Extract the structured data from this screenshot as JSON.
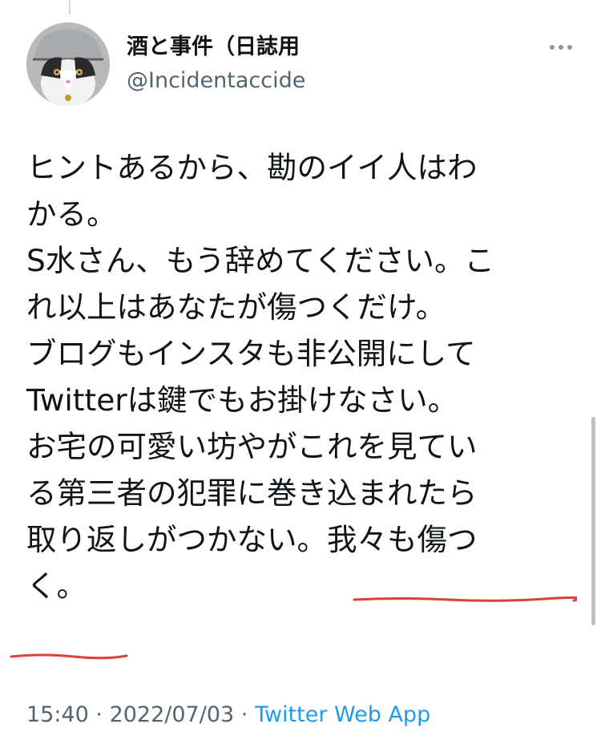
{
  "tweet": {
    "author": {
      "display_name": "酒と事件（日誌用",
      "handle": "@Incidentaccide",
      "avatar_icon": "cat-avatar-icon"
    },
    "more_icon": "more-options-icon",
    "text_lines": [
      "ヒントあるから、勘のイイ人はわ",
      "かる。",
      "S水さん、もう辞めてください。こ",
      "れ以上はあなたが傷つくだけ。",
      "ブログもインスタも非公開にして",
      "Twitterは鍵でもお掛けなさい。",
      "お宅の可愛い坊やがこれを見てい",
      "る第三者の犯罪に巻き込まれたら",
      "取り返しがつかない。我々も傷つ",
      "く。"
    ],
    "annotation_color": "#d9413a",
    "meta": {
      "time": "15:40",
      "separator": " · ",
      "date": "2022/07/03",
      "source": "Twitter Web App"
    },
    "colors": {
      "text": "#0f1419",
      "secondary": "#536471",
      "link": "#1d9bf0"
    }
  }
}
